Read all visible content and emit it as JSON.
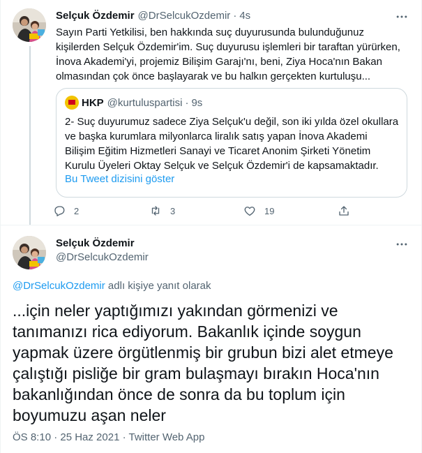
{
  "tweet1": {
    "author_name": "Selçuk Özdemir",
    "author_handle": "@DrSelcukOzdemir",
    "separator": "·",
    "time": "4s",
    "text": "Sayın Parti Yetkilisi, ben hakkında suç duyurusunda bulunduğunuz kişilerden Selçuk Özdemir'im. Suç duyurusu işlemleri bir taraftan yürürken, İnova Akademi'yi, projemiz Bilişim Garajı'nı, beni, Ziya Hoca'nın Bakan olmasından çok önce başlayarak ve bu halkın gerçekten kurtuluşu...",
    "quote": {
      "author_name": "HKP",
      "author_handle": "@kurtuluspartisi",
      "separator": "·",
      "time": "9s",
      "text": "2- Suç duyurumuz sadece Ziya Selçuk'u değil, son iki yılda özel okullara ve başka kurumlara milyonlarca liralık satış yapan İnova Akademi Bilişim Eğitim Hizmetleri Sanayi ve Ticaret Anonim Şirketi Yönetim Kurulu Üyeleri Oktay Selçuk ve Selçuk Özdemir'i de kapsamaktadır.",
      "link": "Bu Tweet dizisini göster"
    },
    "actions": {
      "reply_count": "2",
      "retweet_count": "3",
      "like_count": "19",
      "share_count": ""
    }
  },
  "tweet2": {
    "author_name": "Selçuk Özdemir",
    "author_handle": "@DrSelcukOzdemir",
    "reply_mention": "@DrSelcukOzdemir",
    "reply_suffix": " adlı kişiye yanıt olarak",
    "text": "...için neler yaptığımızı yakından görmenizi ve tanımanızı rica ediyorum.  Bakanlık içinde soygun yapmak üzere örgütlenmiş bir grubun bizi alet etmeye çalıştığı pisliğe bir gram bulaşmayı bırakın Hoca'nın bakanlığından önce de sonra da bu toplum için boyumuzu aşan neler",
    "meta": "ÖS 8:10 · 25 Haz 2021 · Twitter Web App"
  },
  "icons": {
    "more": "more-horizontal-icon",
    "reply": "reply-icon",
    "retweet": "retweet-icon",
    "like": "heart-icon",
    "share": "share-icon"
  },
  "colors": {
    "link": "#1d9bf0",
    "secondary_text": "#536471",
    "border": "#cfd9de"
  }
}
